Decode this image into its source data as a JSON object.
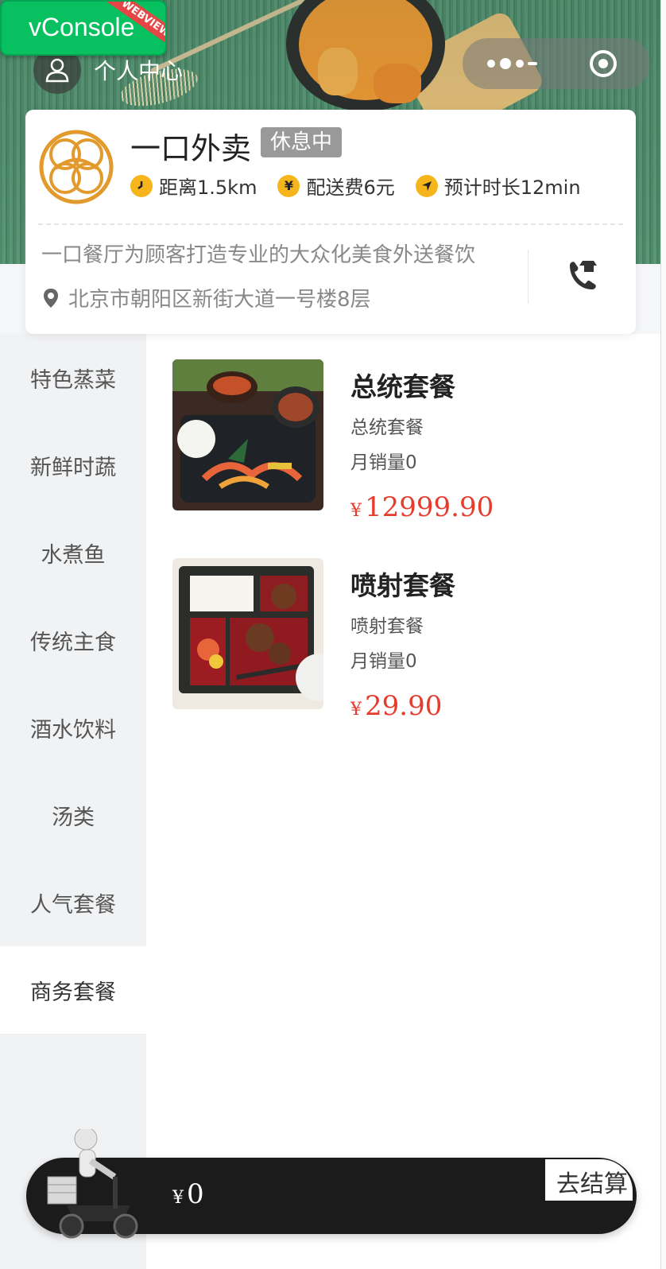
{
  "vconsole": {
    "label": "vConsole",
    "badge": "WEBVIEW"
  },
  "header": {
    "profile_label": "个人中心"
  },
  "store": {
    "name": "一口外卖",
    "status": "休息中",
    "meta": [
      {
        "icon": "clock-icon",
        "text": "距离1.5km"
      },
      {
        "icon": "yen-icon",
        "text": "配送费6元"
      },
      {
        "icon": "navigation-icon",
        "text": "预计时长12min"
      }
    ],
    "description": "一口餐厅为顾客打造专业的大众化美食外送餐饮",
    "address": "北京市朝阳区新街大道一号楼8层"
  },
  "categories": [
    {
      "label": "特色蒸菜",
      "active": false
    },
    {
      "label": "新鲜时蔬",
      "active": false
    },
    {
      "label": "水煮鱼",
      "active": false
    },
    {
      "label": "传统主食",
      "active": false
    },
    {
      "label": "酒水饮料",
      "active": false
    },
    {
      "label": "汤类",
      "active": false
    },
    {
      "label": "人气套餐",
      "active": false
    },
    {
      "label": "商务套餐",
      "active": true
    }
  ],
  "products": [
    {
      "name": "总统套餐",
      "subtitle": "总统套餐",
      "sales": "月销量0",
      "currency": "¥",
      "price": "12999.90"
    },
    {
      "name": "喷射套餐",
      "subtitle": "喷射套餐",
      "sales": "月销量0",
      "currency": "¥",
      "price": "29.90"
    }
  ],
  "cart": {
    "currency": "¥",
    "amount": "0",
    "checkout_label": "去结算"
  },
  "colors": {
    "accent": "#fdc613",
    "price": "#e53c2e",
    "cart_bar": "#1b1b1b",
    "vconsole": "#07c160"
  }
}
